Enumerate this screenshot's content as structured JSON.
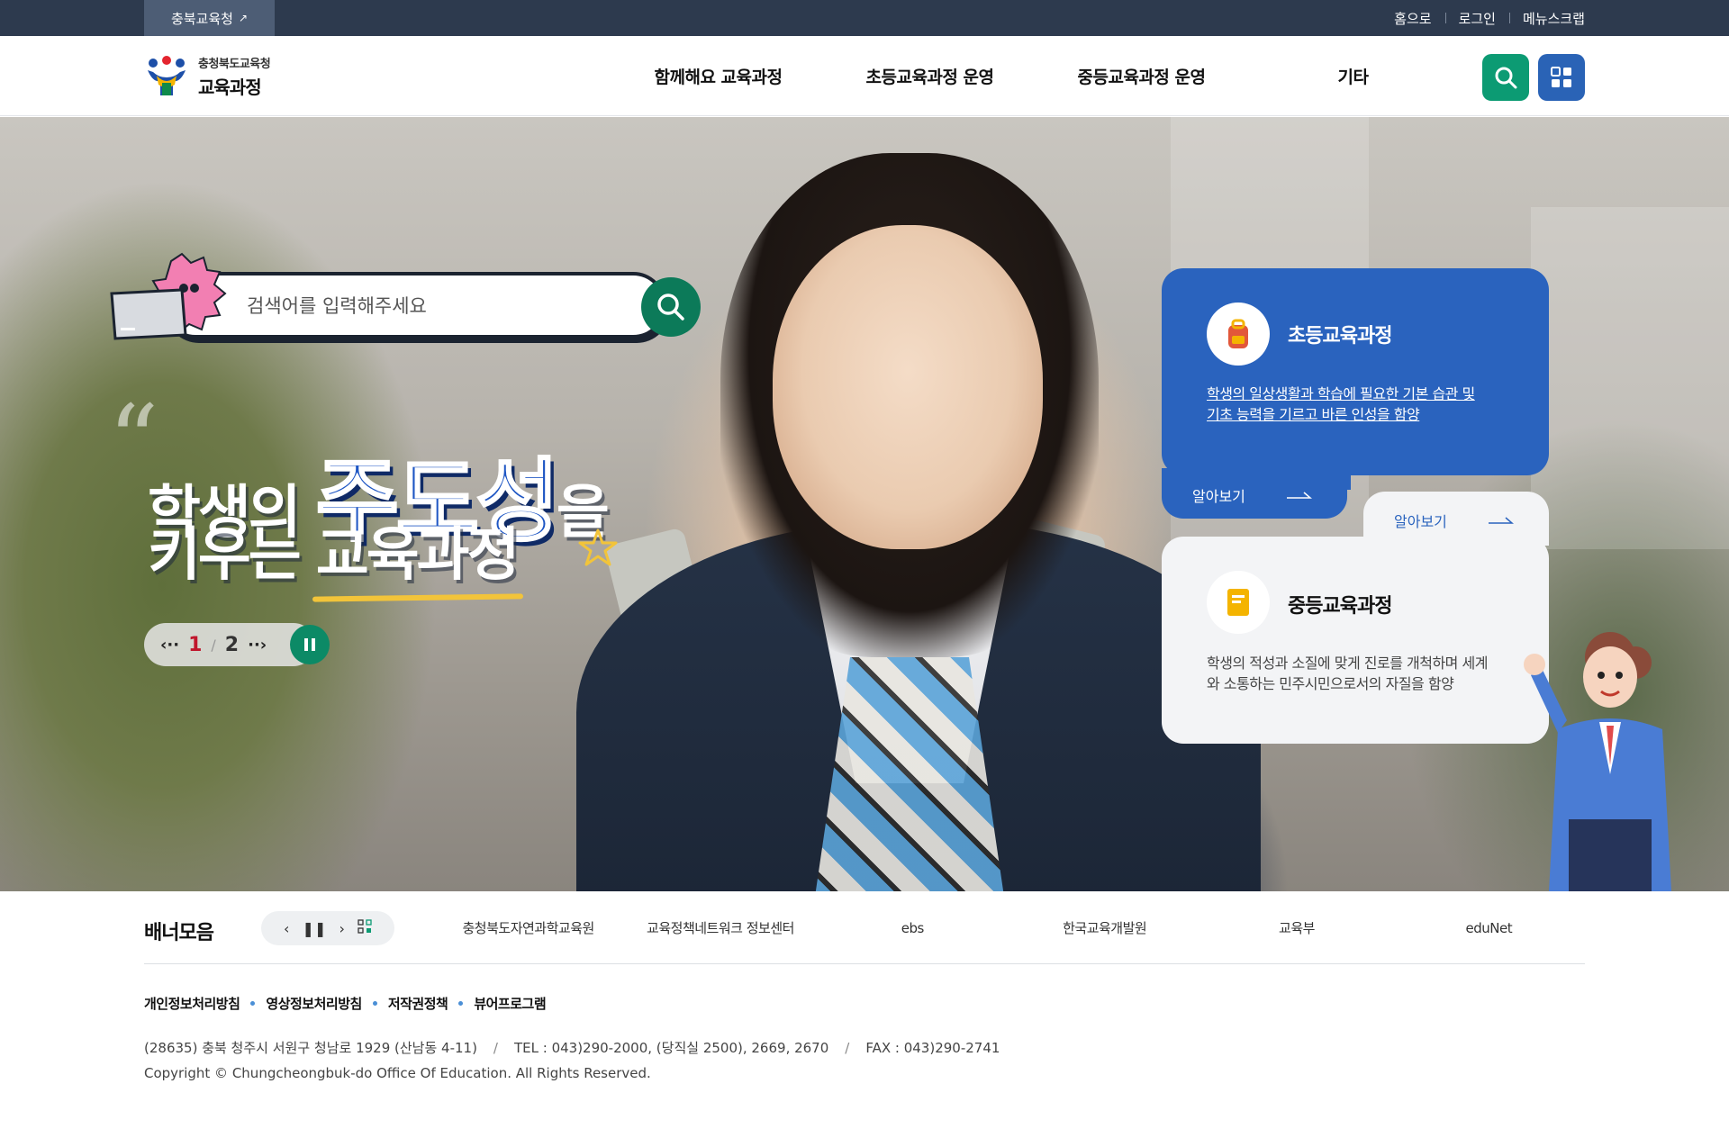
{
  "topbar": {
    "org_link": "충북교육청",
    "util": [
      "홈으로",
      "로그인",
      "메뉴스크랩"
    ]
  },
  "header": {
    "logo_sub": "충청북도교육청",
    "logo_main": "교육과정",
    "nav": [
      "함께해요 교육과정",
      "초등교육과정 운영",
      "중등교육과정 운영",
      "기타"
    ]
  },
  "hero": {
    "search_placeholder": "검색어를 입력해주세요",
    "headline": {
      "line1_pre": "학생의 ",
      "line1_accent": "주도성",
      "line1_post": "을",
      "line2_pre": "키우는 ",
      "line2_underline": "교육과정"
    },
    "pager": {
      "current": "1",
      "total": "2"
    }
  },
  "cards": {
    "elementary": {
      "title": "초등교육과정",
      "desc_line1": "학생의 일상생활과 학습에 필요한 기본 습관 및",
      "desc_line2": "기초 능력을 기르고 바른 인성을 함양",
      "more": "알아보기"
    },
    "secondary": {
      "title": "중등교육과정",
      "desc_line1": "학생의 적성과 소질에 맞게 진로를 개척하며 세계",
      "desc_line2": "와 소통하는 민주시민으로서의 자질을 함양",
      "more": "알아보기"
    }
  },
  "banner": {
    "title": "배너모음",
    "links": [
      "충청북도자연과학교육원",
      "교육정책네트워크 정보센터",
      "ebs",
      "한국교육개발원",
      "교육부",
      "eduNet"
    ]
  },
  "footer": {
    "links": [
      "개인정보처리방침",
      "영상정보처리방침",
      "저작권정책",
      "뷰어프로그램"
    ],
    "address": "(28635) 충북 청주시 서원구 청남로 1929 (산남동 4-11)",
    "tel": "TEL : 043)290-2000, (당직실 2500), 2669, 2670",
    "fax": "FAX : 043)290-2741",
    "copyright": "Copyright © Chungcheongbuk-do Office Of Education. All Rights Reserved."
  },
  "colors": {
    "topbar": "#2d3a4e",
    "accent_green": "#0c9b73",
    "accent_blue": "#2a63b6",
    "card_blue": "#2a63be",
    "pager_current": "#c0162c"
  }
}
